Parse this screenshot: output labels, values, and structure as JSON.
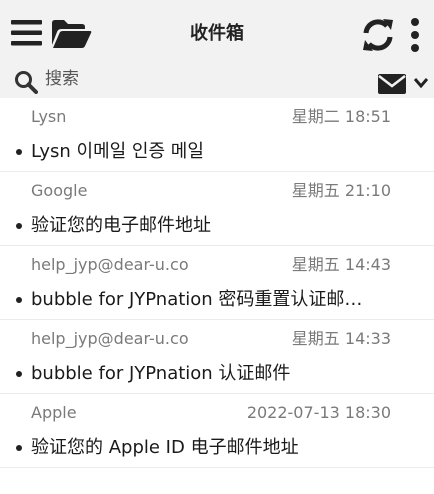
{
  "toolbar": {
    "title": "收件箱",
    "icons": [
      "menu-icon",
      "folder-icon",
      "refresh-icon",
      "more-icon"
    ]
  },
  "search": {
    "placeholder": "搜索",
    "icons": [
      "search-icon",
      "mail-icon",
      "chevron-down-icon"
    ]
  },
  "emails": [
    {
      "sender": "Lysn",
      "time": "星期二 18:51",
      "subject": "Lysn 이메일 인증 메일"
    },
    {
      "sender": "Google",
      "time": "星期五 21:10",
      "subject": "验证您的电子邮件地址"
    },
    {
      "sender": "help_jyp@dear-u.co",
      "time": "星期五 14:43",
      "subject": "bubble for JYPnation 密码重置认证邮…"
    },
    {
      "sender": "help_jyp@dear-u.co",
      "time": "星期五 14:33",
      "subject": "bubble for JYPnation 认证邮件"
    },
    {
      "sender": "Apple",
      "time": "2022-07-13 18:30",
      "subject": "验证您的 Apple ID 电子邮件地址"
    }
  ],
  "colors": {
    "toolbar_bg": "#f2f2f2",
    "icon": "#222222",
    "secondary_text": "#7a7a7a"
  }
}
